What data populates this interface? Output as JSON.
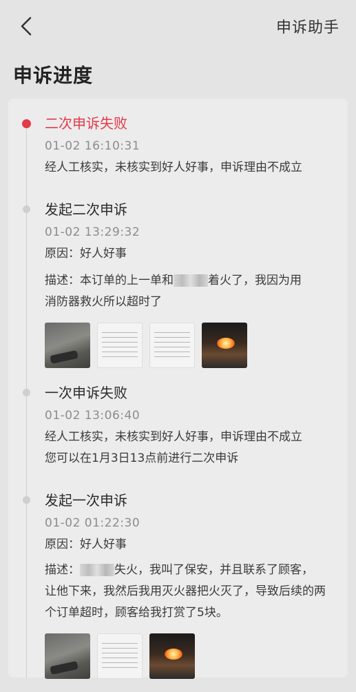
{
  "header": {
    "helper_label": "申诉助手"
  },
  "page": {
    "title": "申诉进度"
  },
  "timeline": {
    "e1": {
      "title": "二次申诉失败",
      "time": "01-02 16:10:31",
      "text": "经人工核实，未核实到好人好事，申诉理由不成立"
    },
    "e2": {
      "title": "发起二次申诉",
      "time": "01-02 13:29:32",
      "reason": "原因：好人好事",
      "desc_prefix": "描述：本订单的上一单和",
      "desc_suffix": "着火了，我因为用",
      "desc_line2": "消防器救火所以超时了",
      "images": [
        "scene-photo",
        "document-screenshot",
        "document-screenshot",
        "fire-video-frame"
      ]
    },
    "e3": {
      "title": "一次申诉失败",
      "time": "01-02 13:06:40",
      "text1": "经人工核实，未核实到好人好事，申诉理由不成立",
      "text2": "您可以在1月3日13点前进行二次申诉"
    },
    "e4": {
      "title": "发起一次申诉",
      "time": "01-02 01:22:30",
      "reason": "原因：好人好事",
      "desc_prefix": "描述：",
      "desc_suffix": "失火，我叫了保安，并且联系了顾客，",
      "desc_line2": "让他下来，我然后我用灭火器把火灭了，导致后续的两",
      "desc_line3": "个订单超时，顾客给我打赏了5块。",
      "images": [
        "scene-photo",
        "document-screenshot",
        "fire-video-frame"
      ]
    }
  },
  "colors": {
    "accent": "#e23a4a",
    "muted": "#8c8c8c",
    "background": "#e4e4e4",
    "card": "#ececec"
  }
}
